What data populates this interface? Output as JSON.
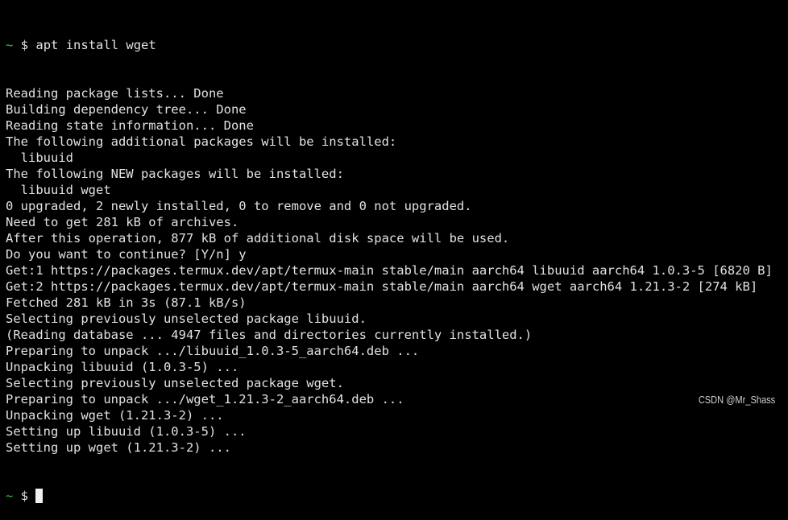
{
  "terminal": {
    "prompt_tilde": "~",
    "prompt_symbol": "$",
    "command": "apt install wget",
    "output_lines": [
      "Reading package lists... Done",
      "Building dependency tree... Done",
      "Reading state information... Done",
      "The following additional packages will be installed:",
      "  libuuid",
      "The following NEW packages will be installed:",
      "  libuuid wget",
      "0 upgraded, 2 newly installed, 0 to remove and 0 not upgraded.",
      "Need to get 281 kB of archives.",
      "After this operation, 877 kB of additional disk space will be used.",
      "Do you want to continue? [Y/n] y",
      "Get:1 https://packages.termux.dev/apt/termux-main stable/main aarch64 libuuid aarch64 1.0.3-5 [6820 B]",
      "Get:2 https://packages.termux.dev/apt/termux-main stable/main aarch64 wget aarch64 1.21.3-2 [274 kB]",
      "Fetched 281 kB in 3s (87.1 kB/s)",
      "Selecting previously unselected package libuuid.",
      "(Reading database ... 4947 files and directories currently installed.)",
      "Preparing to unpack .../libuuid_1.0.3-5_aarch64.deb ...",
      "Unpacking libuuid (1.0.3-5) ...",
      "Selecting previously unselected package wget.",
      "Preparing to unpack .../wget_1.21.3-2_aarch64.deb ...",
      "Unpacking wget (1.21.3-2) ...",
      "Setting up libuuid (1.0.3-5) ...",
      "Setting up wget (1.21.3-2) ..."
    ]
  },
  "watermark": "CSDN @Mr_Shass",
  "colors": {
    "background": "#000000",
    "text": "#e2e2e2",
    "prompt_tilde": "#3fbf3f"
  }
}
